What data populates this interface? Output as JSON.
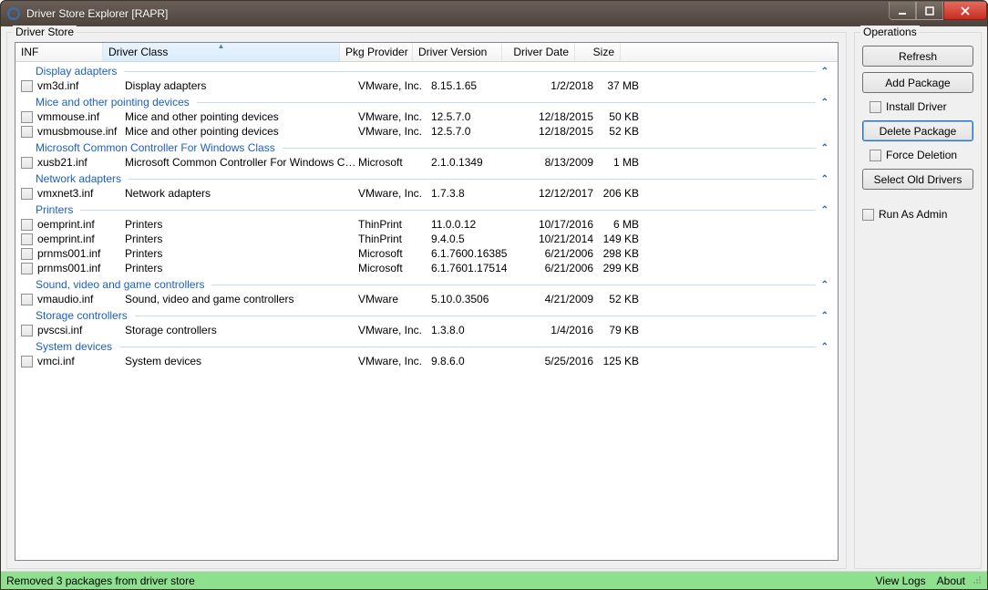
{
  "window": {
    "title": "Driver Store Explorer [RAPR]"
  },
  "panels": {
    "driver_store": "Driver Store",
    "operations": "Operations"
  },
  "columns": {
    "inf": "INF",
    "driver_class": "Driver Class",
    "pkg_provider": "Pkg Provider",
    "driver_version": "Driver Version",
    "driver_date": "Driver Date",
    "size": "Size",
    "sorted_column": "driver_class",
    "sort_direction": "asc"
  },
  "groups": [
    {
      "name": "Display adapters",
      "rows": [
        {
          "inf": "vm3d.inf",
          "class": "Display adapters",
          "provider": "VMware, Inc.",
          "version": "8.15.1.65",
          "date": "1/2/2018",
          "size": "37 MB"
        }
      ]
    },
    {
      "name": "Mice and other pointing devices",
      "rows": [
        {
          "inf": "vmmouse.inf",
          "class": "Mice and other pointing devices",
          "provider": "VMware, Inc.",
          "version": "12.5.7.0",
          "date": "12/18/2015",
          "size": "50 KB"
        },
        {
          "inf": "vmusbmouse.inf",
          "class": "Mice and other pointing devices",
          "provider": "VMware, Inc.",
          "version": "12.5.7.0",
          "date": "12/18/2015",
          "size": "52 KB"
        }
      ]
    },
    {
      "name": "Microsoft Common Controller For Windows Class",
      "rows": [
        {
          "inf": "xusb21.inf",
          "class": "Microsoft Common Controller For Windows Class",
          "provider": "Microsoft",
          "version": "2.1.0.1349",
          "date": "8/13/2009",
          "size": "1 MB"
        }
      ]
    },
    {
      "name": "Network adapters",
      "rows": [
        {
          "inf": "vmxnet3.inf",
          "class": "Network adapters",
          "provider": "VMware, Inc.",
          "version": "1.7.3.8",
          "date": "12/12/2017",
          "size": "206 KB"
        }
      ]
    },
    {
      "name": "Printers",
      "rows": [
        {
          "inf": "oemprint.inf",
          "class": "Printers",
          "provider": "ThinPrint",
          "version": "11.0.0.12",
          "date": "10/17/2016",
          "size": "6 MB"
        },
        {
          "inf": "oemprint.inf",
          "class": "Printers",
          "provider": "ThinPrint",
          "version": "9.4.0.5",
          "date": "10/21/2014",
          "size": "149 KB"
        },
        {
          "inf": "prnms001.inf",
          "class": "Printers",
          "provider": "Microsoft",
          "version": "6.1.7600.16385",
          "date": "6/21/2006",
          "size": "298 KB"
        },
        {
          "inf": "prnms001.inf",
          "class": "Printers",
          "provider": "Microsoft",
          "version": "6.1.7601.17514",
          "date": "6/21/2006",
          "size": "299 KB"
        }
      ]
    },
    {
      "name": "Sound, video and game controllers",
      "rows": [
        {
          "inf": "vmaudio.inf",
          "class": "Sound, video and game controllers",
          "provider": "VMware",
          "version": "5.10.0.3506",
          "date": "4/21/2009",
          "size": "52 KB"
        }
      ]
    },
    {
      "name": "Storage controllers",
      "rows": [
        {
          "inf": "pvscsi.inf",
          "class": "Storage controllers",
          "provider": "VMware, Inc.",
          "version": "1.3.8.0",
          "date": "1/4/2016",
          "size": "79 KB"
        }
      ]
    },
    {
      "name": "System devices",
      "rows": [
        {
          "inf": "vmci.inf",
          "class": "System devices",
          "provider": "VMware, Inc.",
          "version": "9.8.6.0",
          "date": "5/25/2016",
          "size": "125 KB"
        }
      ]
    }
  ],
  "operations": {
    "refresh": "Refresh",
    "add_package": "Add Package",
    "install_driver": "Install Driver",
    "delete_package": "Delete Package",
    "force_deletion": "Force Deletion",
    "select_old_drivers": "Select Old Drivers",
    "run_as_admin": "Run As Admin"
  },
  "status": {
    "message": "Removed 3 packages from driver store",
    "view_logs": "View Logs",
    "about": "About"
  }
}
